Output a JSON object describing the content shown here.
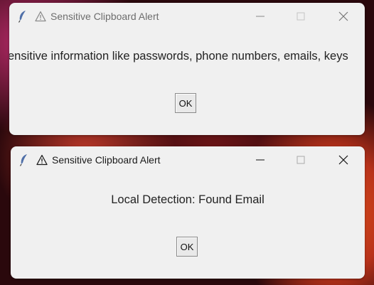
{
  "windows": [
    {
      "title": "Sensitive Clipboard Alert",
      "message": "Sensitive information like passwords, phone numbers, emails, keys",
      "ok_label": "OK",
      "active": false
    },
    {
      "title": "Sensitive Clipboard Alert",
      "message": "Local Detection: Found Email",
      "ok_label": "OK",
      "active": true
    }
  ],
  "icons": {
    "app": "feather-icon",
    "warning": "warning-icon",
    "minimize": "minimize-icon",
    "maximize": "maximize-icon",
    "close": "close-icon"
  },
  "colors": {
    "dialog_bg": "#f0f0f0",
    "inactive_title": "#6d6d6d",
    "active_title": "#1a1a1a"
  }
}
